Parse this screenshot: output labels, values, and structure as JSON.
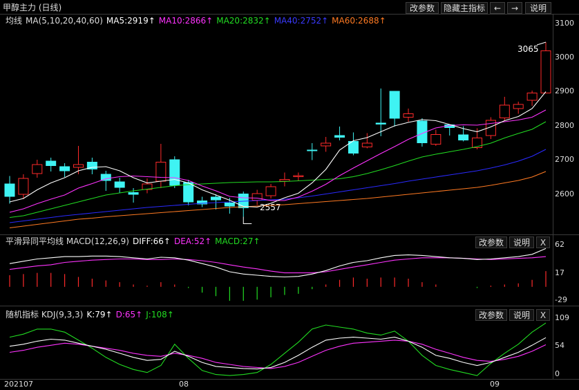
{
  "header": {
    "title": "甲醇主力 (日线)",
    "buttons": {
      "params": "改参数",
      "hide": "隐藏主指标",
      "prev": "←",
      "next": "→",
      "help": "说明"
    }
  },
  "panes": {
    "main": {
      "indicator": "均线",
      "legend": {
        "name": "MA(5,10,20,40,60)",
        "ma5": "MA5:2919↑",
        "ma10": "MA10:2866↑",
        "ma20": "MA20:2832↑",
        "ma40": "MA40:2752↑",
        "ma60": "MA60:2688↑"
      },
      "annotations": {
        "high": "3065",
        "low": "2557"
      },
      "yticks": [
        "3100",
        "3000",
        "2900",
        "2800",
        "2700",
        "2600"
      ]
    },
    "macd": {
      "legend": {
        "name": "平滑异同平均线 MACD(12,26,9)",
        "diff": "DIFF:66↑",
        "dea": "DEA:52↑",
        "macd": "MACD:27↑"
      },
      "yticks": [
        "62",
        "17",
        "-29"
      ],
      "buttons": {
        "params": "改参数",
        "help": "说明",
        "close": "X"
      }
    },
    "kdj": {
      "legend": {
        "name": "随机指标 KDJ(9,3,3)",
        "k": "K:79↑",
        "d": "D:65↑",
        "j": "J:108↑"
      },
      "yticks": [
        "109",
        "54",
        "0"
      ],
      "buttons": {
        "params": "改参数",
        "help": "说明",
        "close": "X"
      }
    }
  },
  "xticks": [
    "202107",
    "08",
    "09"
  ],
  "colors": {
    "up": "#ff2a2a",
    "down": "#3ff3f3",
    "ma5": "#ffffff",
    "ma10": "#ff33ff",
    "ma20": "#22dd22",
    "ma40": "#2a2aff",
    "ma60": "#ff7a22",
    "macd_diff": "#ffffff",
    "macd_dea": "#ff33ff",
    "macd_pos": "#ff2a2a",
    "macd_neg": "#22dd22",
    "kdj_k": "#ffffff",
    "kdj_d": "#ff33ff",
    "kdj_j": "#22dd22"
  },
  "chart_data": [
    {
      "type": "candlestick",
      "ylim": [
        2520,
        3120
      ],
      "candles": [
        [
          2652,
          2616,
          2675,
          2595
        ],
        [
          2622,
          2668,
          2680,
          2608
        ],
        [
          2682,
          2708,
          2722,
          2670
        ],
        [
          2718,
          2705,
          2728,
          2688
        ],
        [
          2702,
          2690,
          2712,
          2672
        ],
        [
          2700,
          2708,
          2762,
          2680
        ],
        [
          2715,
          2695,
          2728,
          2680
        ],
        [
          2680,
          2662,
          2690,
          2632
        ],
        [
          2658,
          2642,
          2670,
          2625
        ],
        [
          2627,
          2622,
          2640,
          2598
        ],
        [
          2636,
          2652,
          2668,
          2625
        ],
        [
          2660,
          2715,
          2768,
          2640
        ],
        [
          2722,
          2648,
          2732,
          2640
        ],
        [
          2656,
          2600,
          2664,
          2590
        ],
        [
          2603,
          2594,
          2615,
          2585
        ],
        [
          2614,
          2606,
          2622,
          2578
        ],
        [
          2597,
          2588,
          2612,
          2566
        ],
        [
          2623,
          2583,
          2630,
          2557
        ],
        [
          2605,
          2624,
          2635,
          2591
        ],
        [
          2618,
          2644,
          2652,
          2610
        ],
        [
          2660,
          2665,
          2685,
          2645
        ],
        [
          2673,
          2676,
          2685,
          2660
        ],
        [
          2750,
          2748,
          2770,
          2721
        ],
        [
          2762,
          2770,
          2788,
          2745
        ],
        [
          2792,
          2787,
          2818,
          2778
        ],
        [
          2775,
          2741,
          2801,
          2735
        ],
        [
          2759,
          2770,
          2799,
          2755
        ],
        [
          2828,
          2825,
          2928,
          2790
        ],
        [
          2920,
          2842,
          2915,
          2818
        ],
        [
          2845,
          2855,
          2870,
          2832
        ],
        [
          2834,
          2771,
          2842,
          2760
        ],
        [
          2767,
          2795,
          2809,
          2762
        ],
        [
          2823,
          2815,
          2818,
          2792
        ],
        [
          2794,
          2779,
          2819,
          2775
        ],
        [
          2757,
          2785,
          2813,
          2752
        ],
        [
          2792,
          2836,
          2845,
          2782
        ],
        [
          2843,
          2880,
          2904,
          2835
        ],
        [
          2870,
          2882,
          2890,
          2855
        ],
        [
          2894,
          2915,
          2922,
          2878
        ],
        [
          2915,
          3037,
          3062,
          2915
        ]
      ],
      "ma5": [
        2600,
        2610,
        2635,
        2655,
        2670,
        2690,
        2700,
        2702,
        2690,
        2670,
        2655,
        2660,
        2665,
        2655,
        2635,
        2620,
        2605,
        2587,
        2585,
        2596,
        2612,
        2625,
        2655,
        2694,
        2750,
        2777,
        2786,
        2803,
        2820,
        2830,
        2838,
        2835,
        2824,
        2812,
        2803,
        2817,
        2835,
        2847,
        2870,
        2919
      ],
      "ma10": [
        2570,
        2580,
        2595,
        2608,
        2620,
        2640,
        2653,
        2667,
        2673,
        2675,
        2673,
        2671,
        2670,
        2662,
        2646,
        2632,
        2616,
        2612,
        2611,
        2604,
        2604,
        2614,
        2631,
        2651,
        2676,
        2698,
        2719,
        2740,
        2760,
        2781,
        2798,
        2814,
        2821,
        2823,
        2822,
        2827,
        2832,
        2837,
        2845,
        2866
      ],
      "ma20": [
        2555,
        2560,
        2570,
        2580,
        2590,
        2600,
        2610,
        2620,
        2626,
        2632,
        2637,
        2642,
        2647,
        2650,
        2652,
        2654,
        2656,
        2657,
        2658,
        2658,
        2659,
        2661,
        2663,
        2665,
        2667,
        2673,
        2682,
        2693,
        2705,
        2718,
        2730,
        2738,
        2745,
        2752,
        2760,
        2770,
        2785,
        2798,
        2810,
        2832
      ],
      "ma40": [
        2540,
        2545,
        2550,
        2555,
        2560,
        2564,
        2568,
        2572,
        2576,
        2580,
        2584,
        2587,
        2590,
        2593,
        2596,
        2598,
        2600,
        2602,
        2604,
        2606,
        2608,
        2612,
        2617,
        2623,
        2629,
        2635,
        2641,
        2647,
        2653,
        2660,
        2666,
        2672,
        2678,
        2684,
        2690,
        2698,
        2707,
        2718,
        2732,
        2752
      ],
      "ma60": [
        2525,
        2530,
        2535,
        2540,
        2545,
        2550,
        2553,
        2557,
        2560,
        2563,
        2566,
        2569,
        2572,
        2575,
        2578,
        2581,
        2584,
        2586,
        2588,
        2590,
        2592,
        2595,
        2598,
        2601,
        2604,
        2607,
        2610,
        2614,
        2618,
        2622,
        2626,
        2630,
        2634,
        2638,
        2642,
        2648,
        2655,
        2662,
        2672,
        2688
      ]
    },
    {
      "type": "bar",
      "series_name": "MACD",
      "ylim": [
        -30,
        70
      ],
      "diff": [
        40,
        44,
        48,
        50,
        52,
        52,
        53,
        53,
        52,
        50,
        48,
        51,
        50,
        46,
        40,
        34,
        26,
        22,
        20,
        18,
        17,
        18,
        22,
        28,
        36,
        42,
        45,
        50,
        54,
        55,
        54,
        52,
        50,
        49,
        47,
        48,
        50,
        52,
        56,
        66
      ],
      "dea": [
        30,
        33,
        36,
        38,
        42,
        44,
        46,
        47,
        48,
        48,
        47,
        47,
        48,
        47,
        45,
        42,
        38,
        34,
        31,
        27,
        24,
        24,
        24,
        26,
        30,
        34,
        38,
        42,
        46,
        48,
        50,
        50,
        50,
        49,
        48,
        47,
        48,
        49,
        50,
        52
      ],
      "macd": [
        20,
        22,
        24,
        24,
        22,
        17,
        14,
        11,
        8,
        4,
        2,
        8,
        4,
        -2,
        -10,
        -16,
        -24,
        -24,
        -22,
        -18,
        -14,
        -12,
        -4,
        4,
        12,
        16,
        14,
        16,
        16,
        14,
        8,
        4,
        0,
        0,
        -2,
        2,
        4,
        6,
        12,
        27
      ]
    },
    {
      "type": "line",
      "series_name": "KDJ",
      "ylim": [
        0,
        115
      ],
      "k": [
        62,
        66,
        72,
        76,
        74,
        68,
        62,
        56,
        48,
        40,
        34,
        36,
        52,
        42,
        30,
        22,
        20,
        18,
        17,
        20,
        30,
        44,
        60,
        74,
        78,
        80,
        78,
        76,
        80,
        72,
        60,
        44,
        38,
        30,
        24,
        30,
        40,
        50,
        64,
        79
      ],
      "d": [
        50,
        54,
        60,
        64,
        68,
        66,
        62,
        58,
        54,
        48,
        44,
        42,
        48,
        44,
        38,
        30,
        26,
        22,
        20,
        18,
        22,
        30,
        42,
        54,
        62,
        68,
        70,
        72,
        74,
        72,
        66,
        56,
        48,
        40,
        34,
        32,
        36,
        42,
        52,
        65
      ],
      "j": [
        80,
        86,
        96,
        96,
        90,
        74,
        58,
        40,
        26,
        16,
        10,
        24,
        66,
        38,
        14,
        6,
        4,
        6,
        10,
        26,
        48,
        70,
        96,
        104,
        100,
        96,
        88,
        84,
        92,
        72,
        44,
        24,
        16,
        10,
        4,
        28,
        48,
        66,
        90,
        108
      ]
    }
  ]
}
